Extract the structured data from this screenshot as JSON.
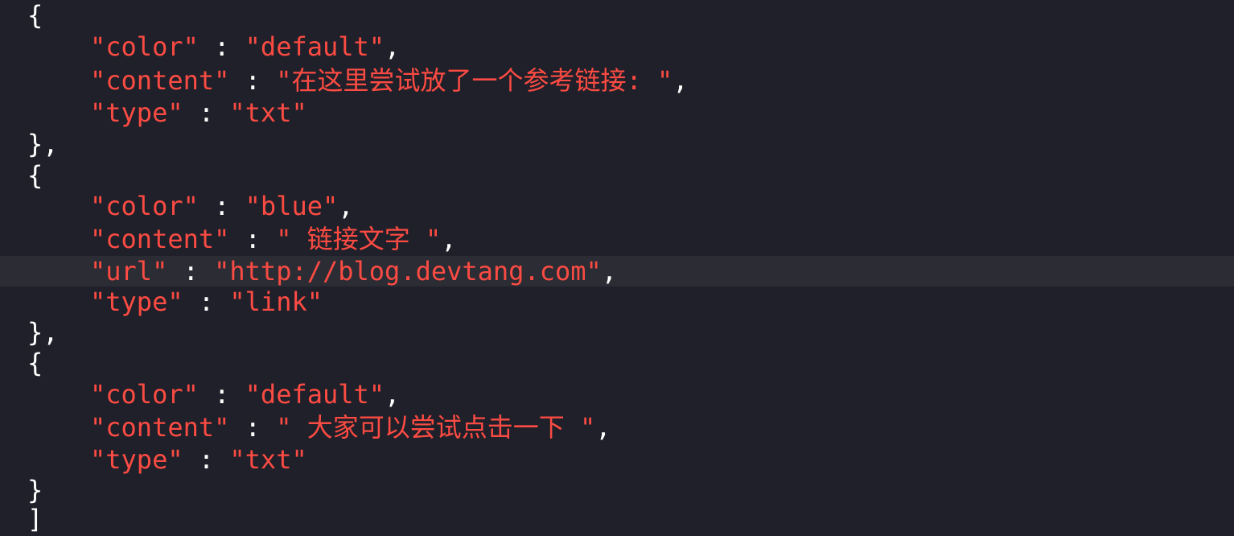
{
  "editor": {
    "highlight_color": "#2b2c34",
    "string_color": "#fc4b43",
    "punctuation_color": "#ffffff",
    "background_color": "#1f2029",
    "lines": [
      {
        "kind": "punct",
        "text": "{"
      },
      {
        "kind": "kv",
        "key": "\"color\"",
        "sep": " : ",
        "value": "\"default\"",
        "end": ","
      },
      {
        "kind": "kv",
        "key": "\"content\"",
        "sep": " : ",
        "value": "\"在这里尝试放了一个参考链接: \"",
        "end": ","
      },
      {
        "kind": "kv",
        "key": "\"type\"",
        "sep": " : ",
        "value": "\"txt\"",
        "end": ""
      },
      {
        "kind": "punct",
        "text": "},"
      },
      {
        "kind": "punct",
        "text": "{"
      },
      {
        "kind": "kv",
        "key": "\"color\"",
        "sep": " : ",
        "value": "\"blue\"",
        "end": ","
      },
      {
        "kind": "kv",
        "key": "\"content\"",
        "sep": " : ",
        "value": "\" 链接文字 \"",
        "end": ","
      },
      {
        "kind": "kv",
        "key": "\"url\"",
        "sep": " : ",
        "value": "\"http://blog.devtang.com\"",
        "end": ",",
        "current": true
      },
      {
        "kind": "kv",
        "key": "\"type\"",
        "sep": " : ",
        "value": "\"link\"",
        "end": ""
      },
      {
        "kind": "punct",
        "text": "},"
      },
      {
        "kind": "punct",
        "text": "{"
      },
      {
        "kind": "kv",
        "key": "\"color\"",
        "sep": " : ",
        "value": "\"default\"",
        "end": ","
      },
      {
        "kind": "kv",
        "key": "\"content\"",
        "sep": " : ",
        "value": "\" 大家可以尝试点击一下 \"",
        "end": ","
      },
      {
        "kind": "kv",
        "key": "\"type\"",
        "sep": " : ",
        "value": "\"txt\"",
        "end": ""
      },
      {
        "kind": "punct",
        "text": "}"
      },
      {
        "kind": "punct",
        "text": "]"
      }
    ]
  }
}
